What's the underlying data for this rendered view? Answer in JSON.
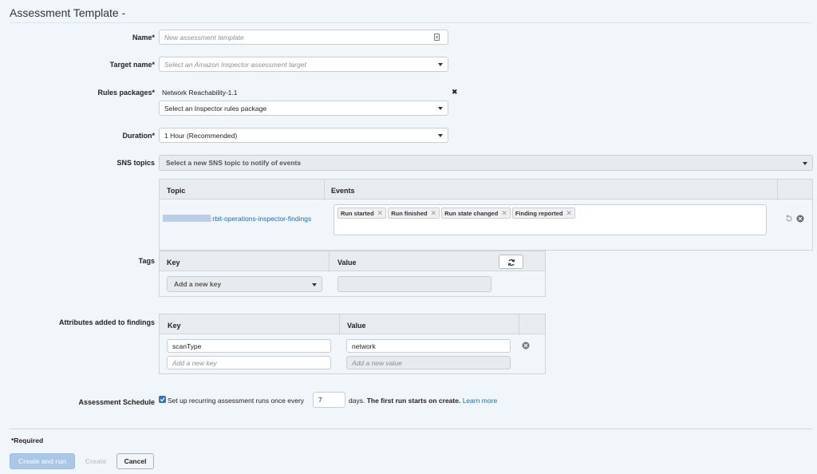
{
  "header": {
    "title": "Assessment Template -"
  },
  "name": {
    "label": "Name*",
    "placeholder": "New assessment template"
  },
  "target": {
    "label": "Target name*",
    "placeholder": "Select an Amazon Inspector assessment target"
  },
  "rules": {
    "label": "Rules packages*",
    "selected": "Network Reachability-1.1",
    "remove_glyph": "✖",
    "select_placeholder": "Select an Inspector rules package"
  },
  "duration": {
    "label": "Duration*",
    "value": "1 Hour (Recommended)"
  },
  "sns": {
    "label": "SNS topics",
    "select_placeholder": "Select a new SNS topic to notify of events",
    "col_topic": "Topic",
    "col_events": "Events",
    "topic_suffix": ":rbit-operations-inspector-findings",
    "events": [
      "Run started",
      "Run finished",
      "Run state changed",
      "Finding reported"
    ]
  },
  "tags": {
    "label": "Tags",
    "col_key": "Key",
    "col_value": "Value",
    "key_placeholder": "Add a new key"
  },
  "attributes": {
    "label": "Attributes added to findings",
    "col_key": "Key",
    "col_value": "Value",
    "rows": [
      {
        "key": "scanType",
        "value": "network"
      }
    ],
    "key_placeholder": "Add a new key",
    "value_placeholder": "Add a new value"
  },
  "schedule": {
    "label": "Assessment Schedule",
    "checked": true,
    "text_before": "Set up recurring assessment runs once every",
    "days_value": "7",
    "text_days": "days.",
    "text_bold": "The first run starts on create.",
    "learn_more": "Learn more"
  },
  "footer": {
    "required_note": "*Required",
    "create_and_run": "Create and run",
    "create": "Create",
    "cancel": "Cancel"
  },
  "colors": {
    "link": "#1f6bb5",
    "primary_disabled": "#a9c7e6"
  }
}
